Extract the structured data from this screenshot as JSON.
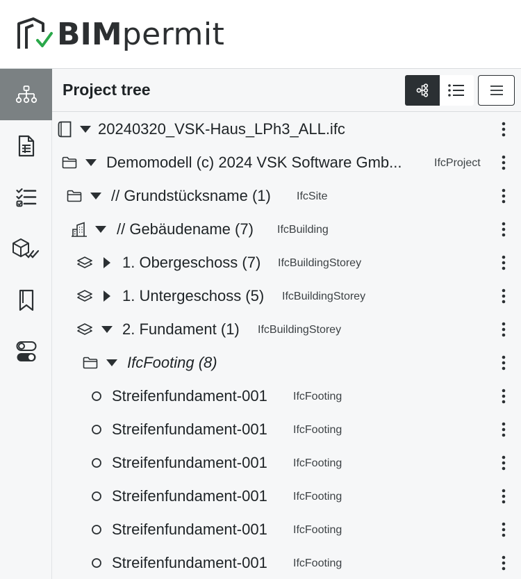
{
  "brand": {
    "bold": "BIM",
    "light": "permit"
  },
  "sidebar": {
    "items": [
      {
        "name": "project-tree",
        "icon": "hierarchy-icon",
        "active": true
      },
      {
        "name": "documents",
        "icon": "document-icon",
        "active": false
      },
      {
        "name": "checklist",
        "icon": "checklist-icon",
        "active": false
      },
      {
        "name": "model-check",
        "icon": "cube-check-icon",
        "active": false
      },
      {
        "name": "bookmarks",
        "icon": "bookmark-icon",
        "active": false
      },
      {
        "name": "settings",
        "icon": "toggle-icon",
        "active": false
      }
    ]
  },
  "panel": {
    "title": "Project tree",
    "view_toggle": {
      "tree_icon": "tree-view-icon",
      "list_icon": "list-view-icon",
      "active": "tree"
    },
    "menu_icon": "hamburger-menu-icon"
  },
  "tree": {
    "rows": [
      {
        "icon": "file-icon",
        "expanded": true,
        "label": "20240320_VSK-Haus_LPh3_ALL.ifc",
        "type": ""
      },
      {
        "icon": "folder-icon",
        "expanded": true,
        "label": "Demomodell (c) 2024 VSK Software Gmb...",
        "type": "IfcProject"
      },
      {
        "icon": "folder-icon",
        "expanded": true,
        "label": "// Grundstücksname (1)",
        "type": "IfcSite"
      },
      {
        "icon": "building-icon",
        "expanded": true,
        "label": "// Gebäudename (7)",
        "type": "IfcBuilding"
      },
      {
        "icon": "layers-icon",
        "expanded": false,
        "label": "1. Obergeschoss (7)",
        "type": "IfcBuildingStorey"
      },
      {
        "icon": "layers-icon",
        "expanded": false,
        "label": "1. Untergeschoss (5)",
        "type": "IfcBuildingStorey"
      },
      {
        "icon": "layers-icon",
        "expanded": true,
        "label": "2. Fundament (1)",
        "type": "IfcBuildingStorey"
      },
      {
        "icon": "folder-icon",
        "expanded": true,
        "label": "IfcFooting (8)",
        "type": ""
      },
      {
        "icon": "circle-icon",
        "expanded": null,
        "label": "Streifenfundament-001",
        "type": "IfcFooting"
      },
      {
        "icon": "circle-icon",
        "expanded": null,
        "label": "Streifenfundament-001",
        "type": "IfcFooting"
      },
      {
        "icon": "circle-icon",
        "expanded": null,
        "label": "Streifenfundament-001",
        "type": "IfcFooting"
      },
      {
        "icon": "circle-icon",
        "expanded": null,
        "label": "Streifenfundament-001",
        "type": "IfcFooting"
      },
      {
        "icon": "circle-icon",
        "expanded": null,
        "label": "Streifenfundament-001",
        "type": "IfcFooting"
      },
      {
        "icon": "circle-icon",
        "expanded": null,
        "label": "Streifenfundament-001",
        "type": "IfcFooting"
      }
    ]
  },
  "colors": {
    "accent_check": "#2aa84a",
    "dark": "#2b3033",
    "sidebar_active": "#7b8183",
    "panel_bg": "#f6f7f8"
  }
}
